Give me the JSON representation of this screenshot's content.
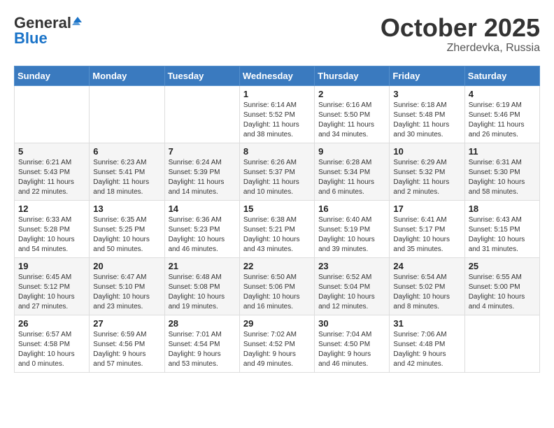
{
  "header": {
    "logo": {
      "general": "General",
      "blue": "Blue"
    },
    "title": "October 2025",
    "location": "Zherdevka, Russia"
  },
  "weekdays": [
    "Sunday",
    "Monday",
    "Tuesday",
    "Wednesday",
    "Thursday",
    "Friday",
    "Saturday"
  ],
  "weeks": [
    [
      {
        "day": "",
        "info": ""
      },
      {
        "day": "",
        "info": ""
      },
      {
        "day": "",
        "info": ""
      },
      {
        "day": "1",
        "info": "Sunrise: 6:14 AM\nSunset: 5:52 PM\nDaylight: 11 hours\nand 38 minutes."
      },
      {
        "day": "2",
        "info": "Sunrise: 6:16 AM\nSunset: 5:50 PM\nDaylight: 11 hours\nand 34 minutes."
      },
      {
        "day": "3",
        "info": "Sunrise: 6:18 AM\nSunset: 5:48 PM\nDaylight: 11 hours\nand 30 minutes."
      },
      {
        "day": "4",
        "info": "Sunrise: 6:19 AM\nSunset: 5:46 PM\nDaylight: 11 hours\nand 26 minutes."
      }
    ],
    [
      {
        "day": "5",
        "info": "Sunrise: 6:21 AM\nSunset: 5:43 PM\nDaylight: 11 hours\nand 22 minutes."
      },
      {
        "day": "6",
        "info": "Sunrise: 6:23 AM\nSunset: 5:41 PM\nDaylight: 11 hours\nand 18 minutes."
      },
      {
        "day": "7",
        "info": "Sunrise: 6:24 AM\nSunset: 5:39 PM\nDaylight: 11 hours\nand 14 minutes."
      },
      {
        "day": "8",
        "info": "Sunrise: 6:26 AM\nSunset: 5:37 PM\nDaylight: 11 hours\nand 10 minutes."
      },
      {
        "day": "9",
        "info": "Sunrise: 6:28 AM\nSunset: 5:34 PM\nDaylight: 11 hours\nand 6 minutes."
      },
      {
        "day": "10",
        "info": "Sunrise: 6:29 AM\nSunset: 5:32 PM\nDaylight: 11 hours\nand 2 minutes."
      },
      {
        "day": "11",
        "info": "Sunrise: 6:31 AM\nSunset: 5:30 PM\nDaylight: 10 hours\nand 58 minutes."
      }
    ],
    [
      {
        "day": "12",
        "info": "Sunrise: 6:33 AM\nSunset: 5:28 PM\nDaylight: 10 hours\nand 54 minutes."
      },
      {
        "day": "13",
        "info": "Sunrise: 6:35 AM\nSunset: 5:25 PM\nDaylight: 10 hours\nand 50 minutes."
      },
      {
        "day": "14",
        "info": "Sunrise: 6:36 AM\nSunset: 5:23 PM\nDaylight: 10 hours\nand 46 minutes."
      },
      {
        "day": "15",
        "info": "Sunrise: 6:38 AM\nSunset: 5:21 PM\nDaylight: 10 hours\nand 43 minutes."
      },
      {
        "day": "16",
        "info": "Sunrise: 6:40 AM\nSunset: 5:19 PM\nDaylight: 10 hours\nand 39 minutes."
      },
      {
        "day": "17",
        "info": "Sunrise: 6:41 AM\nSunset: 5:17 PM\nDaylight: 10 hours\nand 35 minutes."
      },
      {
        "day": "18",
        "info": "Sunrise: 6:43 AM\nSunset: 5:15 PM\nDaylight: 10 hours\nand 31 minutes."
      }
    ],
    [
      {
        "day": "19",
        "info": "Sunrise: 6:45 AM\nSunset: 5:12 PM\nDaylight: 10 hours\nand 27 minutes."
      },
      {
        "day": "20",
        "info": "Sunrise: 6:47 AM\nSunset: 5:10 PM\nDaylight: 10 hours\nand 23 minutes."
      },
      {
        "day": "21",
        "info": "Sunrise: 6:48 AM\nSunset: 5:08 PM\nDaylight: 10 hours\nand 19 minutes."
      },
      {
        "day": "22",
        "info": "Sunrise: 6:50 AM\nSunset: 5:06 PM\nDaylight: 10 hours\nand 16 minutes."
      },
      {
        "day": "23",
        "info": "Sunrise: 6:52 AM\nSunset: 5:04 PM\nDaylight: 10 hours\nand 12 minutes."
      },
      {
        "day": "24",
        "info": "Sunrise: 6:54 AM\nSunset: 5:02 PM\nDaylight: 10 hours\nand 8 minutes."
      },
      {
        "day": "25",
        "info": "Sunrise: 6:55 AM\nSunset: 5:00 PM\nDaylight: 10 hours\nand 4 minutes."
      }
    ],
    [
      {
        "day": "26",
        "info": "Sunrise: 6:57 AM\nSunset: 4:58 PM\nDaylight: 10 hours\nand 0 minutes."
      },
      {
        "day": "27",
        "info": "Sunrise: 6:59 AM\nSunset: 4:56 PM\nDaylight: 9 hours\nand 57 minutes."
      },
      {
        "day": "28",
        "info": "Sunrise: 7:01 AM\nSunset: 4:54 PM\nDaylight: 9 hours\nand 53 minutes."
      },
      {
        "day": "29",
        "info": "Sunrise: 7:02 AM\nSunset: 4:52 PM\nDaylight: 9 hours\nand 49 minutes."
      },
      {
        "day": "30",
        "info": "Sunrise: 7:04 AM\nSunset: 4:50 PM\nDaylight: 9 hours\nand 46 minutes."
      },
      {
        "day": "31",
        "info": "Sunrise: 7:06 AM\nSunset: 4:48 PM\nDaylight: 9 hours\nand 42 minutes."
      },
      {
        "day": "",
        "info": ""
      }
    ]
  ]
}
